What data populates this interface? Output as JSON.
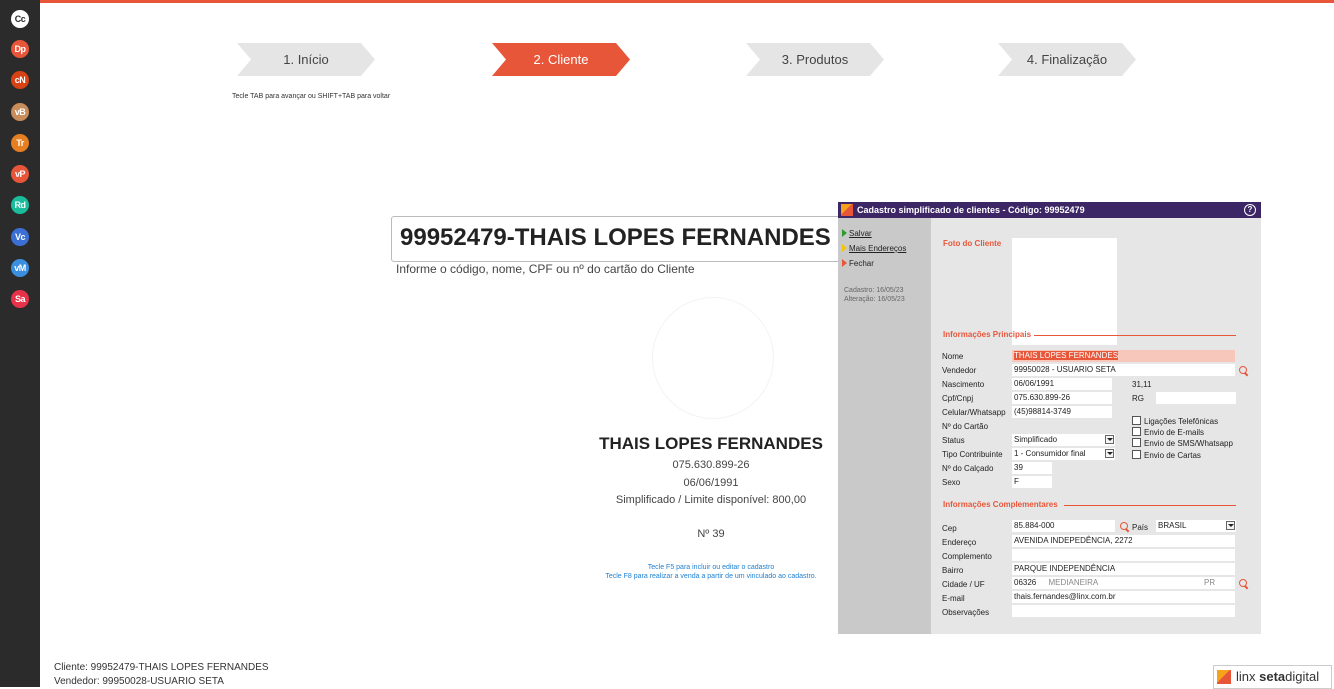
{
  "sidebar": {
    "icons": [
      {
        "label": "Cc",
        "color": "#ffffff",
        "text_color": "#2b2b2b"
      },
      {
        "label": "Dp",
        "color": "#e8563a"
      },
      {
        "label": "cN",
        "color": "#d84315"
      },
      {
        "label": "vB",
        "color": "#c98c5b"
      },
      {
        "label": "Tr",
        "color": "#e67e22"
      },
      {
        "label": "vP",
        "color": "#e8563a"
      },
      {
        "label": "Rd",
        "color": "#1abc9c"
      },
      {
        "label": "Vc",
        "color": "#3b6fd6"
      },
      {
        "label": "vM",
        "color": "#3b8fe0"
      },
      {
        "label": "Sa",
        "color": "#e8324a"
      }
    ]
  },
  "steps": [
    {
      "label": "1. Início"
    },
    {
      "label": "2. Cliente"
    },
    {
      "label": "3. Produtos"
    },
    {
      "label": "4. Finalização"
    }
  ],
  "nav_hint": "Tecle TAB para avançar ou SHIFT+TAB para voltar",
  "search": {
    "value": "99952479-THAIS LOPES FERNANDES",
    "help": "Informe o código, nome, CPF ou nº do cartão do Cliente"
  },
  "customer": {
    "name": "THAIS LOPES FERNANDES",
    "cpf": "075.630.899-26",
    "birth": "06/06/1991",
    "status_line": "Simplificado / Limite disponível: 800,00",
    "number": "Nº 39",
    "hint_f5": "Tecle F5 para incluir ou editar o cadastro",
    "hint_f8": "Tecle F8 para realizar a venda a partir de um vinculado ao cadastro."
  },
  "dialog": {
    "title": "Cadastro simplificado de clientes - Código: 99952479",
    "help": "?",
    "actions": {
      "save": "Salvar",
      "more_addresses": "Mais Endereços",
      "close": "Fechar"
    },
    "meta": {
      "created": "Cadastro: 16/05/23",
      "changed": "Alteração: 16/05/23"
    },
    "sections": {
      "photo": "Foto do Cliente",
      "main": "Informações Principais",
      "extra": "Informações Complementares"
    },
    "labels": {
      "nome": "Nome",
      "vendedor": "Vendedor",
      "nascimento": "Nascimento",
      "cpf": "Cpf/Cnpj",
      "celular": "Celular/Whatsapp",
      "cartao": "Nº do Cartão",
      "status": "Status",
      "tipo": "Tipo Contribuinte",
      "calcado": "Nº do Calçado",
      "sexo": "Sexo",
      "cep": "Cep",
      "pais": "País",
      "endereco": "Endereço",
      "complemento": "Complemento",
      "bairro": "Bairro",
      "cidade": "Cidade / UF",
      "email": "E-mail",
      "obs": "Observações",
      "rg": "RG"
    },
    "values": {
      "nome": "THAIS LOPES FERNANDES",
      "vendedor": "99950028 - USUARIO SETA",
      "nascimento": "06/06/1991",
      "idade": "31,11",
      "cpf": "075.630.899-26",
      "rg": "",
      "celular": "(45)98814-3749",
      "cartao": "",
      "status": "Simplificado",
      "tipo": "1 - Consumidor final",
      "calcado": "39",
      "sexo": "F",
      "cep": "85.884-000",
      "pais": "BRASIL",
      "endereco": "AVENIDA INDEPEDÊNCIA, 2272",
      "complemento": "",
      "bairro": "PARQUE INDEPENDÊNCIA",
      "cidade_cod": "06326",
      "cidade": "MEDIANEIRA",
      "uf": "PR",
      "email": "thais.fernandes@linx.com.br",
      "obs": ""
    },
    "checkboxes": {
      "ligacoes": "Ligações Telefônicas",
      "emails": "Envio de E-mails",
      "sms": "Envio de SMS/Whatsapp",
      "cartas": "Envio de Cartas"
    }
  },
  "footer": {
    "cliente": "Cliente:    99952479-THAIS LOPES FERNANDES",
    "vendedor": "Vendedor: 99950028-USUARIO SETA"
  },
  "brand": {
    "prefix": "linx ",
    "bold": "seta",
    "suffix": "digital"
  }
}
